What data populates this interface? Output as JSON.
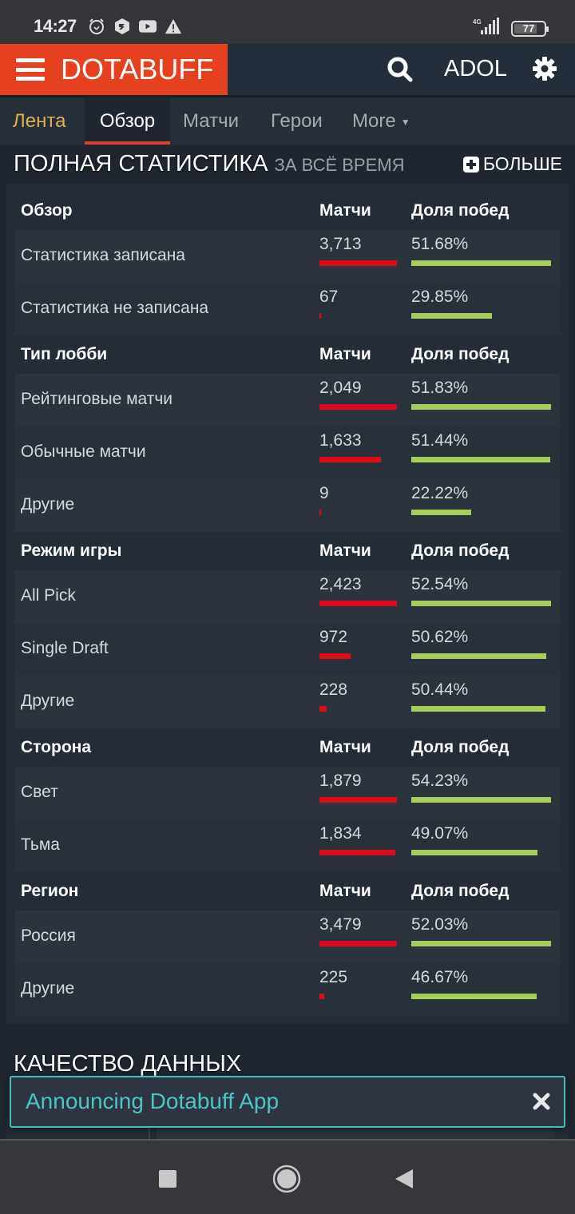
{
  "status_bar": {
    "time": "14:27",
    "icons": [
      "alarm-icon",
      "app-notification-icon",
      "youtube-icon",
      "warning-icon"
    ],
    "network": "4G",
    "battery": "77"
  },
  "header": {
    "brand": "DOTABUFF",
    "user": "ADOL",
    "brand_color": "#e5401f"
  },
  "tabs": [
    {
      "label": "Лента"
    },
    {
      "label": "Обзор"
    },
    {
      "label": "Матчи"
    },
    {
      "label": "Герои"
    },
    {
      "label": "More"
    }
  ],
  "stats": {
    "title": "ПОЛНАЯ СТАТИСТИКА",
    "subtitle": "ЗА ВСЁ ВРЕМЯ",
    "more_label": "БОЛЬШЕ",
    "colors": {
      "matches_bar": "#e0091a",
      "winrate_bar": "#a7cd5b"
    },
    "sections": [
      {
        "header": "Обзор",
        "col_matches": "Матчи",
        "col_winrate": "Доля побед",
        "rows": [
          {
            "label": "Статистика записана",
            "matches": "3,713",
            "matches_value": 3713,
            "winrate": "51.68%",
            "winrate_value": 51.68
          },
          {
            "label": "Статистика не записана",
            "matches": "67",
            "matches_value": 67,
            "winrate": "29.85%",
            "winrate_value": 29.85
          }
        ]
      },
      {
        "header": "Тип лобби",
        "col_matches": "Матчи",
        "col_winrate": "Доля побед",
        "rows": [
          {
            "label": "Рейтинговые матчи",
            "matches": "2,049",
            "matches_value": 2049,
            "winrate": "51.83%",
            "winrate_value": 51.83
          },
          {
            "label": "Обычные матчи",
            "matches": "1,633",
            "matches_value": 1633,
            "winrate": "51.44%",
            "winrate_value": 51.44
          },
          {
            "label": "Другие",
            "matches": "9",
            "matches_value": 9,
            "winrate": "22.22%",
            "winrate_value": 22.22
          }
        ]
      },
      {
        "header": "Режим игры",
        "col_matches": "Матчи",
        "col_winrate": "Доля побед",
        "rows": [
          {
            "label": "All Pick",
            "matches": "2,423",
            "matches_value": 2423,
            "winrate": "52.54%",
            "winrate_value": 52.54
          },
          {
            "label": "Single Draft",
            "matches": "972",
            "matches_value": 972,
            "winrate": "50.62%",
            "winrate_value": 50.62
          },
          {
            "label": "Другие",
            "matches": "228",
            "matches_value": 228,
            "winrate": "50.44%",
            "winrate_value": 50.44
          }
        ]
      },
      {
        "header": "Сторона",
        "col_matches": "Матчи",
        "col_winrate": "Доля побед",
        "rows": [
          {
            "label": "Свет",
            "matches": "1,879",
            "matches_value": 1879,
            "winrate": "54.23%",
            "winrate_value": 54.23
          },
          {
            "label": "Тьма",
            "matches": "1,834",
            "matches_value": 1834,
            "winrate": "49.07%",
            "winrate_value": 49.07
          }
        ]
      },
      {
        "header": "Регион",
        "col_matches": "Матчи",
        "col_winrate": "Доля побед",
        "rows": [
          {
            "label": "Россия",
            "matches": "3,479",
            "matches_value": 3479,
            "winrate": "52.03%",
            "winrate_value": 52.03
          },
          {
            "label": "Другие",
            "matches": "225",
            "matches_value": 225,
            "winrate": "46.67%",
            "winrate_value": 46.67
          }
        ]
      }
    ]
  },
  "data_quality": {
    "title": "КАЧЕСТВО ДАННЫХ"
  },
  "banner": {
    "text": "Announcing Dotabuff App"
  }
}
